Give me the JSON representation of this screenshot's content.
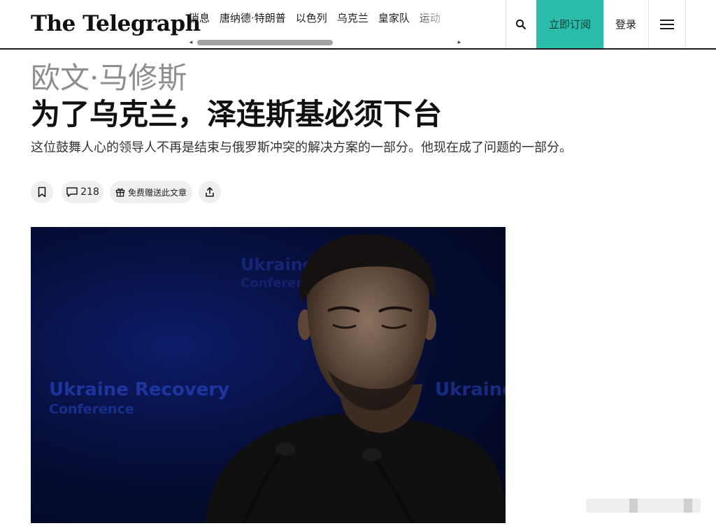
{
  "header": {
    "logo": "The Telegraph",
    "nav_items": [
      "消息",
      "唐纳德·特朗普",
      "以色列",
      "乌克兰",
      "皇家队",
      "运动"
    ],
    "nav_left_arrow": "◂",
    "nav_right_arrow": "▸",
    "search_icon": "search-icon",
    "subscribe_label": "立即订阅",
    "login_label": "登录",
    "menu_icon": "hamburger-menu-icon"
  },
  "article": {
    "author": "欧文·马修斯",
    "headline": "为了乌克兰，泽连斯基必须下台",
    "standfirst": "这位鼓舞人心的领导人不再是结束与俄罗斯冲突的解决方案的一部分。他现在成了问题的一部分。",
    "comment_count": "218",
    "gift_label": "免费赠送此文章"
  },
  "hero": {
    "watermarks": [
      "Ukraine",
      "Conference",
      "Ukraine Recovery",
      "Conference",
      "Ukraine"
    ]
  },
  "colors": {
    "subscribe_bg": "#2bbcaa",
    "header_rule": "#1a1a1a",
    "author_grey": "#8e8e8e"
  }
}
